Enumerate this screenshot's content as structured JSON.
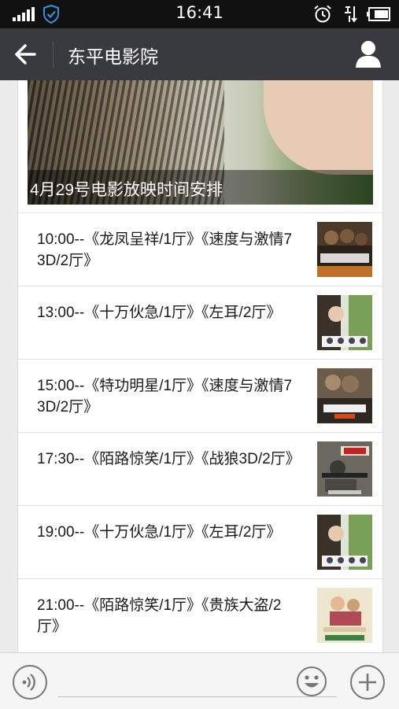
{
  "status_bar": {
    "time": "16:41"
  },
  "nav": {
    "title": "东平电影院"
  },
  "banner": {
    "caption": "4月29号电影放映时间安排"
  },
  "schedule": [
    {
      "text": "10:00--《龙凤呈祥/1厅》《速度与激情7 3D/2厅》",
      "poster": "fast-furious-poster"
    },
    {
      "text": "13:00--《十万伙急/1厅》《左耳/2厅》",
      "poster": "left-ear-poster"
    },
    {
      "text": "15:00--《特功明星/1厅》《速度与激情7 3D/2厅》",
      "poster": "fast-furious-7-poster"
    },
    {
      "text": "17:30--《陌路惊笑/1厅》《战狼3D/2厅》",
      "poster": "wolf-warrior-poster"
    },
    {
      "text": "19:00--《十万伙急/1厅》《左耳/2厅》",
      "poster": "left-ear-poster"
    },
    {
      "text": "21:00--《陌路惊笑/1厅》《贵族大盗/2厅》",
      "poster": "noble-thief-poster"
    }
  ],
  "icons": {
    "signal": "signal-icon",
    "shield": "shield-check-icon",
    "alarm": "alarm-clock-icon",
    "network": "network-icon",
    "battery": "battery-icon",
    "back": "back-arrow-icon",
    "profile": "person-icon",
    "voice": "voice-icon",
    "emoji": "emoji-icon",
    "plus": "plus-icon"
  },
  "colors": {
    "status_bar_bg": "#111111",
    "nav_bg": "#393a3f",
    "page_bg": "#ececec",
    "shield_accent": "#3b8fd9"
  }
}
